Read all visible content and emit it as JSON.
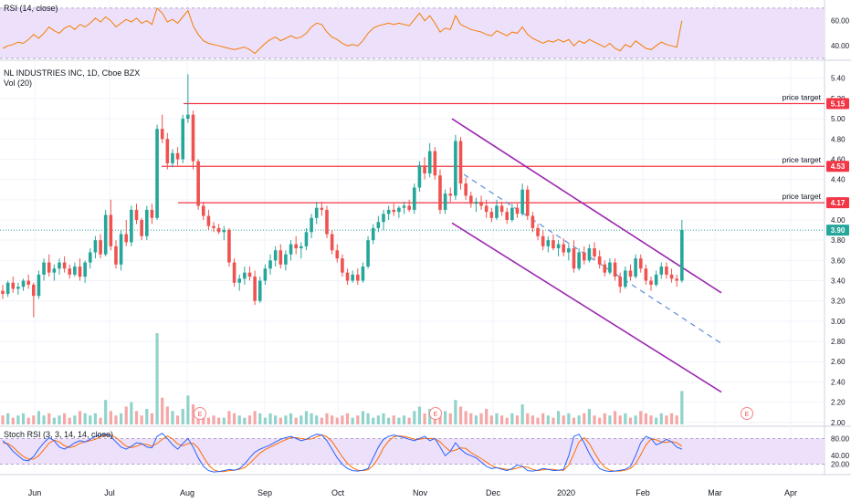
{
  "header": {
    "rsi_title": "RSI (14, close)",
    "main_title": "NL INDUSTRIES INC, 1D, Cboe BZX",
    "vol_title": "Vol (20)",
    "stoch_title": "Stoch RSI (3, 3, 14, 14, close)"
  },
  "colors": {
    "up": "#26a69a",
    "down": "#ef5350",
    "vol_up": "#8fd3cb",
    "vol_down": "#f4a7a6",
    "target": "#f23645",
    "channel": "#9c27b0",
    "dashed": "#5b8fd9",
    "rsi_line": "#f57c00",
    "rsi_band": "#ede0fa",
    "stoch_k": "#2962ff",
    "stoch_d": "#ff6d00",
    "last_price": "#26a69a"
  },
  "chart_data": {
    "type": "candlestick",
    "title": "NL INDUSTRIES INC, 1D, Cboe BZX",
    "x_ticks": [
      "Jun",
      "Jul",
      "Aug",
      "Sep",
      "Oct",
      "Nov",
      "Dec",
      "2020",
      "Feb",
      "Mar",
      "Apr"
    ],
    "price_axis": {
      "ticks": [
        "2.00",
        "2.20",
        "2.40",
        "2.60",
        "2.80",
        "3.00",
        "3.20",
        "3.40",
        "3.60",
        "3.80",
        "4.00",
        "4.20",
        "4.40",
        "4.60",
        "4.80",
        "5.00",
        "5.20",
        "5.40"
      ],
      "range": [
        1.98,
        5.56
      ]
    },
    "last_price": 3.9,
    "last_price_label": "3.90",
    "price_targets": [
      {
        "label": "price target",
        "value": 5.15,
        "value_label": "5.15"
      },
      {
        "label": "price target",
        "value": 4.53,
        "value_label": "4.53"
      },
      {
        "label": "price target",
        "value": 4.17,
        "value_label": "4.17"
      }
    ],
    "channel_lines": [
      {
        "name": "upper",
        "from": [
          "2019-11-05",
          5.0
        ],
        "to": [
          "2020-02-27",
          3.28
        ]
      },
      {
        "name": "lower",
        "from": [
          "2019-11-05",
          3.97
        ],
        "to": [
          "2020-02-27",
          2.3
        ]
      },
      {
        "name": "mid",
        "style": "dashed",
        "from": [
          "2019-11-15",
          4.45
        ],
        "to": [
          "2020-02-27",
          2.78
        ]
      }
    ],
    "earnings_markers": [
      "E",
      "E",
      "E"
    ],
    "ohlc": [
      [
        3.3,
        3.36,
        3.22,
        3.27
      ],
      [
        3.27,
        3.4,
        3.24,
        3.38
      ],
      [
        3.38,
        3.44,
        3.28,
        3.32
      ],
      [
        3.32,
        3.38,
        3.26,
        3.34
      ],
      [
        3.34,
        3.42,
        3.3,
        3.4
      ],
      [
        3.4,
        3.46,
        3.32,
        3.36
      ],
      [
        3.36,
        3.38,
        3.04,
        3.25
      ],
      [
        3.25,
        3.5,
        3.22,
        3.46
      ],
      [
        3.46,
        3.62,
        3.4,
        3.58
      ],
      [
        3.58,
        3.66,
        3.44,
        3.48
      ],
      [
        3.48,
        3.56,
        3.4,
        3.52
      ],
      [
        3.52,
        3.62,
        3.46,
        3.58
      ],
      [
        3.58,
        3.64,
        3.48,
        3.52
      ],
      [
        3.52,
        3.56,
        3.42,
        3.46
      ],
      [
        3.46,
        3.58,
        3.44,
        3.54
      ],
      [
        3.54,
        3.62,
        3.4,
        3.44
      ],
      [
        3.44,
        3.6,
        3.38,
        3.58
      ],
      [
        3.58,
        3.72,
        3.52,
        3.68
      ],
      [
        3.68,
        3.84,
        3.62,
        3.8
      ],
      [
        3.8,
        3.86,
        3.62,
        3.66
      ],
      [
        3.66,
        4.1,
        3.64,
        4.05
      ],
      [
        4.05,
        4.2,
        3.7,
        3.74
      ],
      [
        3.74,
        3.8,
        3.52,
        3.56
      ],
      [
        3.56,
        3.9,
        3.5,
        3.86
      ],
      [
        3.86,
        4.0,
        3.74,
        3.78
      ],
      [
        3.78,
        4.14,
        3.74,
        4.1
      ],
      [
        4.1,
        4.16,
        3.96,
        4.0
      ],
      [
        4.0,
        4.02,
        3.8,
        3.84
      ],
      [
        3.84,
        4.14,
        3.8,
        4.1
      ],
      [
        4.1,
        4.16,
        3.96,
        4.02
      ],
      [
        4.02,
        4.94,
        4.0,
        4.9
      ],
      [
        4.9,
        5.04,
        4.76,
        4.8
      ],
      [
        4.8,
        4.86,
        4.5,
        4.56
      ],
      [
        4.56,
        4.7,
        4.52,
        4.66
      ],
      [
        4.66,
        4.72,
        4.54,
        4.6
      ],
      [
        4.6,
        5.04,
        4.56,
        5.0
      ],
      [
        5.0,
        5.44,
        4.96,
        5.04
      ],
      [
        5.04,
        5.08,
        4.5,
        4.58
      ],
      [
        4.58,
        4.6,
        4.1,
        4.14
      ],
      [
        4.14,
        4.18,
        4.0,
        4.04
      ],
      [
        4.04,
        4.1,
        3.9,
        3.94
      ],
      [
        3.94,
        3.98,
        3.88,
        3.92
      ],
      [
        3.92,
        3.96,
        3.86,
        3.88
      ],
      [
        3.88,
        3.94,
        3.8,
        3.9
      ],
      [
        3.9,
        3.92,
        3.54,
        3.58
      ],
      [
        3.58,
        3.62,
        3.34,
        3.38
      ],
      [
        3.38,
        3.46,
        3.3,
        3.42
      ],
      [
        3.42,
        3.54,
        3.36,
        3.48
      ],
      [
        3.48,
        3.54,
        3.4,
        3.44
      ],
      [
        3.44,
        3.5,
        3.16,
        3.2
      ],
      [
        3.2,
        3.44,
        3.18,
        3.4
      ],
      [
        3.4,
        3.56,
        3.36,
        3.52
      ],
      [
        3.52,
        3.66,
        3.46,
        3.6
      ],
      [
        3.6,
        3.74,
        3.54,
        3.7
      ],
      [
        3.7,
        3.76,
        3.52,
        3.56
      ],
      [
        3.56,
        3.7,
        3.5,
        3.66
      ],
      [
        3.66,
        3.8,
        3.6,
        3.76
      ],
      [
        3.76,
        3.84,
        3.66,
        3.72
      ],
      [
        3.72,
        3.78,
        3.62,
        3.74
      ],
      [
        3.74,
        3.92,
        3.7,
        3.88
      ],
      [
        3.88,
        4.06,
        3.82,
        4.02
      ],
      [
        4.02,
        4.18,
        3.96,
        4.12
      ],
      [
        4.12,
        4.18,
        4.04,
        4.1
      ],
      [
        4.1,
        4.14,
        3.82,
        3.86
      ],
      [
        3.86,
        3.9,
        3.66,
        3.7
      ],
      [
        3.7,
        3.76,
        3.58,
        3.62
      ],
      [
        3.62,
        3.66,
        3.44,
        3.48
      ],
      [
        3.48,
        3.52,
        3.36,
        3.4
      ],
      [
        3.4,
        3.5,
        3.38,
        3.46
      ],
      [
        3.46,
        3.52,
        3.36,
        3.4
      ],
      [
        3.4,
        3.58,
        3.38,
        3.54
      ],
      [
        3.54,
        3.84,
        3.52,
        3.8
      ],
      [
        3.8,
        3.96,
        3.76,
        3.92
      ],
      [
        3.92,
        4.04,
        3.88,
        3.98
      ],
      [
        3.98,
        4.1,
        3.9,
        4.06
      ],
      [
        4.06,
        4.14,
        4.0,
        4.1
      ],
      [
        4.1,
        4.16,
        4.04,
        4.08
      ],
      [
        4.08,
        4.14,
        4.02,
        4.12
      ],
      [
        4.12,
        4.18,
        4.06,
        4.14
      ],
      [
        4.14,
        4.2,
        4.08,
        4.1
      ],
      [
        4.1,
        4.36,
        4.06,
        4.32
      ],
      [
        4.32,
        4.58,
        4.28,
        4.54
      ],
      [
        4.54,
        4.62,
        4.4,
        4.46
      ],
      [
        4.46,
        4.76,
        4.42,
        4.68
      ],
      [
        4.68,
        4.72,
        4.4,
        4.44
      ],
      [
        4.44,
        4.5,
        4.06,
        4.1
      ],
      [
        4.1,
        4.3,
        4.06,
        4.26
      ],
      [
        4.26,
        4.32,
        4.18,
        4.24
      ],
      [
        4.24,
        4.84,
        4.2,
        4.78
      ],
      [
        4.78,
        4.82,
        4.3,
        4.36
      ],
      [
        4.36,
        4.42,
        4.2,
        4.24
      ],
      [
        4.24,
        4.28,
        4.12,
        4.16
      ],
      [
        4.16,
        4.22,
        4.08,
        4.18
      ],
      [
        4.18,
        4.24,
        4.1,
        4.14
      ],
      [
        4.14,
        4.2,
        4.02,
        4.08
      ],
      [
        4.08,
        4.12,
        3.98,
        4.02
      ],
      [
        4.02,
        4.2,
        4.0,
        4.14
      ],
      [
        4.14,
        4.18,
        4.04,
        4.08
      ],
      [
        4.08,
        4.12,
        3.96,
        4.0
      ],
      [
        4.0,
        4.16,
        3.98,
        4.12
      ],
      [
        4.12,
        4.16,
        4.02,
        4.06
      ],
      [
        4.06,
        4.36,
        4.04,
        4.3
      ],
      [
        4.3,
        4.34,
        4.0,
        4.04
      ],
      [
        4.04,
        4.08,
        3.88,
        3.92
      ],
      [
        3.92,
        3.96,
        3.8,
        3.84
      ],
      [
        3.84,
        3.9,
        3.7,
        3.74
      ],
      [
        3.74,
        3.84,
        3.68,
        3.8
      ],
      [
        3.8,
        3.86,
        3.7,
        3.72
      ],
      [
        3.72,
        3.8,
        3.64,
        3.76
      ],
      [
        3.76,
        3.82,
        3.64,
        3.68
      ],
      [
        3.68,
        3.76,
        3.6,
        3.72
      ],
      [
        3.72,
        3.8,
        3.48,
        3.52
      ],
      [
        3.52,
        3.72,
        3.5,
        3.68
      ],
      [
        3.68,
        3.74,
        3.56,
        3.6
      ],
      [
        3.6,
        3.76,
        3.58,
        3.72
      ],
      [
        3.72,
        3.78,
        3.6,
        3.64
      ],
      [
        3.64,
        3.7,
        3.52,
        3.56
      ],
      [
        3.56,
        3.6,
        3.44,
        3.48
      ],
      [
        3.48,
        3.62,
        3.46,
        3.58
      ],
      [
        3.58,
        3.62,
        3.4,
        3.44
      ],
      [
        3.44,
        3.48,
        3.28,
        3.34
      ],
      [
        3.34,
        3.54,
        3.32,
        3.5
      ],
      [
        3.5,
        3.56,
        3.4,
        3.44
      ],
      [
        3.44,
        3.66,
        3.42,
        3.62
      ],
      [
        3.62,
        3.66,
        3.48,
        3.52
      ],
      [
        3.52,
        3.56,
        3.36,
        3.4
      ],
      [
        3.4,
        3.44,
        3.3,
        3.36
      ],
      [
        3.36,
        3.5,
        3.34,
        3.46
      ],
      [
        3.46,
        3.58,
        3.42,
        3.54
      ],
      [
        3.54,
        3.58,
        3.42,
        3.46
      ],
      [
        3.46,
        3.52,
        3.38,
        3.42
      ],
      [
        3.42,
        3.46,
        3.34,
        3.4
      ],
      [
        3.4,
        4.0,
        3.38,
        3.9
      ]
    ],
    "volume": [
      0.4,
      0.5,
      0.3,
      0.4,
      0.5,
      0.3,
      0.4,
      0.6,
      0.4,
      0.5,
      0.3,
      0.4,
      0.5,
      0.3,
      0.4,
      0.6,
      0.5,
      0.4,
      0.5,
      0.3,
      1.1,
      0.6,
      0.4,
      0.5,
      0.8,
      1.0,
      0.6,
      0.4,
      0.7,
      0.5,
      4.1,
      1.2,
      0.8,
      0.6,
      0.4,
      0.7,
      1.3,
      0.9,
      0.6,
      0.4,
      0.3,
      0.4,
      0.3,
      0.3,
      0.6,
      0.5,
      0.4,
      0.3,
      0.4,
      0.6,
      0.5,
      0.3,
      0.5,
      0.4,
      0.3,
      0.4,
      0.5,
      0.3,
      0.4,
      0.6,
      0.5,
      0.4,
      0.3,
      0.5,
      0.4,
      0.3,
      0.4,
      0.5,
      0.3,
      0.4,
      0.6,
      0.5,
      0.3,
      0.4,
      0.5,
      0.3,
      0.4,
      0.3,
      0.4,
      0.3,
      0.6,
      0.8,
      0.5,
      0.7,
      0.5,
      0.4,
      0.6,
      0.5,
      1.1,
      0.8,
      0.6,
      0.5,
      0.4,
      0.5,
      0.7,
      0.4,
      0.5,
      0.4,
      0.3,
      0.5,
      0.4,
      0.9,
      0.5,
      0.4,
      0.3,
      0.5,
      0.4,
      0.3,
      0.6,
      0.4,
      0.5,
      0.3,
      0.4,
      0.5,
      0.7,
      0.4,
      0.3,
      0.5,
      0.4,
      0.6,
      0.4,
      0.5,
      0.3,
      0.4,
      0.6,
      0.5,
      0.4,
      0.3,
      0.5,
      0.4,
      0.5,
      0.4,
      1.5
    ],
    "rsi": {
      "title": "RSI (14, close)",
      "axis_ticks": [
        "60.00",
        "40.00"
      ],
      "range": [
        30,
        75
      ],
      "band": [
        30,
        70
      ],
      "values": [
        38,
        40,
        41,
        43,
        42,
        45,
        49,
        46,
        50,
        55,
        52,
        50,
        54,
        56,
        53,
        57,
        55,
        58,
        62,
        59,
        63,
        60,
        55,
        58,
        61,
        59,
        62,
        58,
        60,
        57,
        70,
        66,
        59,
        61,
        58,
        63,
        68,
        56,
        49,
        44,
        42,
        41,
        40,
        39,
        38,
        37,
        38,
        39,
        37,
        34,
        38,
        42,
        45,
        47,
        44,
        46,
        48,
        46,
        47,
        50,
        55,
        58,
        57,
        51,
        47,
        45,
        42,
        40,
        41,
        40,
        44,
        50,
        54,
        56,
        57,
        58,
        57,
        58,
        57,
        56,
        61,
        66,
        60,
        64,
        58,
        51,
        54,
        53,
        64,
        57,
        55,
        53,
        52,
        51,
        49,
        48,
        52,
        50,
        48,
        51,
        50,
        55,
        49,
        46,
        44,
        42,
        44,
        43,
        45,
        43,
        45,
        40,
        44,
        42,
        45,
        43,
        41,
        39,
        42,
        38,
        36,
        41,
        39,
        44,
        41,
        38,
        37,
        40,
        43,
        41,
        40,
        39,
        60
      ]
    },
    "stoch_rsi": {
      "title": "Stoch RSI (3, 3, 14, 14, close)",
      "axis_ticks": [
        "80.00",
        "40.00",
        "20.00"
      ],
      "range": [
        0,
        100
      ],
      "band": [
        20,
        80
      ],
      "k": [
        75,
        65,
        50,
        40,
        30,
        28,
        38,
        55,
        70,
        82,
        75,
        60,
        55,
        62,
        70,
        75,
        72,
        78,
        85,
        88,
        90,
        85,
        72,
        60,
        55,
        62,
        70,
        68,
        60,
        58,
        85,
        92,
        80,
        65,
        55,
        68,
        80,
        60,
        35,
        15,
        5,
        2,
        3,
        5,
        8,
        6,
        10,
        20,
        35,
        48,
        55,
        60,
        65,
        72,
        78,
        82,
        85,
        80,
        75,
        78,
        85,
        90,
        88,
        75,
        55,
        35,
        20,
        10,
        5,
        4,
        6,
        10,
        35,
        60,
        78,
        85,
        88,
        85,
        82,
        78,
        75,
        80,
        85,
        75,
        80,
        60,
        40,
        50,
        70,
        55,
        45,
        40,
        35,
        25,
        15,
        10,
        12,
        8,
        5,
        10,
        18,
        15,
        5,
        4,
        6,
        10,
        8,
        5,
        6,
        8,
        40,
        85,
        90,
        70,
        45,
        25,
        10,
        5,
        3,
        4,
        6,
        8,
        15,
        40,
        70,
        85,
        80,
        65,
        70,
        78,
        72,
        60,
        55
      ],
      "d": [
        70,
        68,
        60,
        48,
        38,
        32,
        32,
        40,
        54,
        69,
        76,
        72,
        63,
        59,
        62,
        69,
        72,
        75,
        78,
        84,
        88,
        88,
        82,
        72,
        62,
        59,
        62,
        67,
        66,
        62,
        68,
        78,
        86,
        79,
        67,
        63,
        68,
        69,
        58,
        37,
        18,
        7,
        3,
        3,
        5,
        6,
        8,
        12,
        22,
        34,
        46,
        54,
        60,
        66,
        72,
        77,
        82,
        82,
        80,
        78,
        79,
        84,
        88,
        84,
        73,
        55,
        37,
        22,
        12,
        6,
        5,
        7,
        17,
        35,
        58,
        74,
        84,
        86,
        85,
        82,
        78,
        78,
        80,
        80,
        80,
        72,
        60,
        50,
        53,
        58,
        57,
        47,
        40,
        33,
        25,
        17,
        12,
        10,
        8,
        8,
        11,
        14,
        13,
        8,
        5,
        7,
        8,
        8,
        6,
        6,
        18,
        44,
        72,
        82,
        68,
        47,
        27,
        13,
        6,
        4,
        4,
        6,
        10,
        21,
        42,
        65,
        78,
        77,
        72,
        71,
        73,
        70,
        62
      ]
    }
  }
}
